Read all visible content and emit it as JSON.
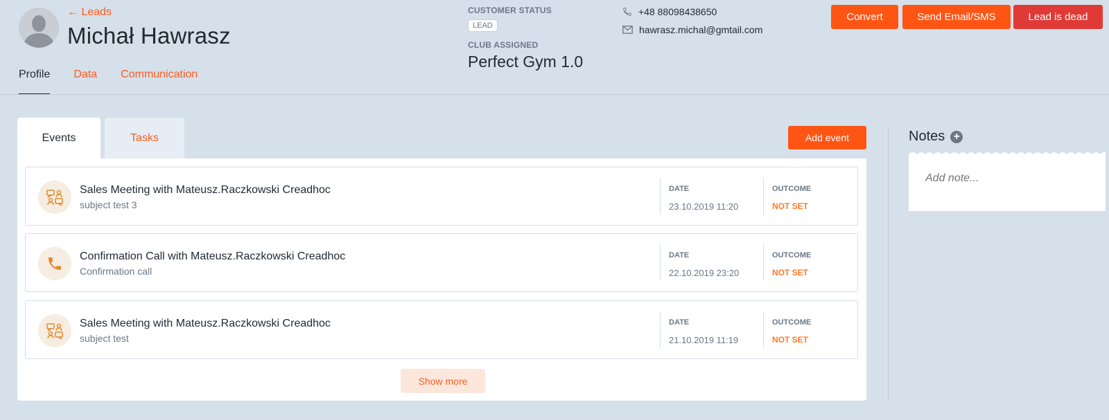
{
  "header": {
    "back_label": "← Leads",
    "name": "Michał Hawrasz",
    "customer_status_label": "CUSTOMER STATUS",
    "customer_status_value": "LEAD",
    "club_label": "CLUB ASSIGNED",
    "club_value": "Perfect Gym 1.0",
    "phone": "+48 88098438650",
    "email": "hawrasz.michal@gmtail.com",
    "buttons": {
      "convert": "Convert",
      "send": "Send Email/SMS",
      "dead": "Lead is dead"
    },
    "tabs": [
      "Profile",
      "Data",
      "Communication"
    ]
  },
  "panel": {
    "tabs": [
      "Events",
      "Tasks"
    ],
    "add_event": "Add event",
    "events": [
      {
        "icon": "meeting-icon",
        "title": "Sales Meeting with Mateusz.Raczkowski Creadhoc",
        "subtitle": "subject test 3",
        "date_label": "DATE",
        "date": "23.10.2019 11:20",
        "outcome_label": "OUTCOME",
        "outcome": "NOT SET"
      },
      {
        "icon": "phone-icon",
        "title": "Confirmation Call with Mateusz.Raczkowski Creadhoc",
        "subtitle": "Confirmation call",
        "date_label": "DATE",
        "date": "22.10.2019 23:20",
        "outcome_label": "OUTCOME",
        "outcome": "NOT SET"
      },
      {
        "icon": "meeting-icon",
        "title": "Sales Meeting with Mateusz.Raczkowski Creadhoc",
        "subtitle": "subject test",
        "date_label": "DATE",
        "date": "21.10.2019 11:19",
        "outcome_label": "OUTCOME",
        "outcome": "NOT SET"
      }
    ],
    "show_more": "Show more"
  },
  "notes": {
    "title": "Notes",
    "add_symbol": "+",
    "placeholder": "Add note..."
  },
  "colors": {
    "accent": "#ff5514",
    "danger": "#e03a36",
    "background": "#d6e0ea",
    "outcome": "#ff7a2a"
  }
}
